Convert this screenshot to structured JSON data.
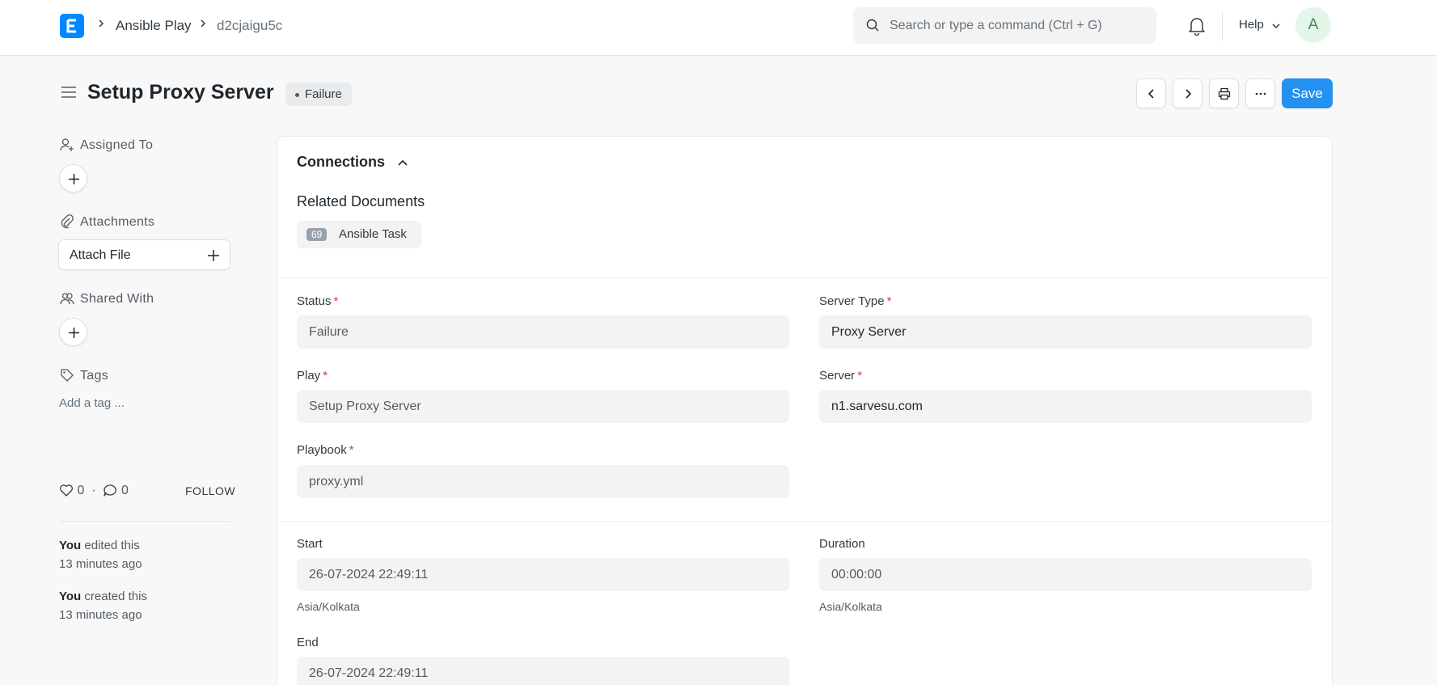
{
  "navbar": {
    "breadcrumbs": [
      "Ansible Play",
      "d2cjaigu5c"
    ],
    "search_placeholder": "Search or type a command (Ctrl + G)",
    "help_label": "Help",
    "avatar_initial": "A"
  },
  "page": {
    "title": "Setup Proxy Server",
    "status": "Failure",
    "save_label": "Save"
  },
  "sidebar": {
    "assigned_to": "Assigned To",
    "attachments": "Attachments",
    "attach_file": "Attach File",
    "shared_with": "Shared With",
    "tags": "Tags",
    "add_tag": "Add a tag ...",
    "likes": "0",
    "comments": "0",
    "follow": "FOLLOW",
    "activity": [
      {
        "who": "You",
        "action": "edited this",
        "when": "13 minutes ago"
      },
      {
        "who": "You",
        "action": "created this",
        "when": "13 minutes ago"
      }
    ]
  },
  "connections": {
    "title": "Connections",
    "related_documents": "Related Documents",
    "doc_count": "69",
    "doc_name": "Ansible Task"
  },
  "fields": {
    "status": {
      "label": "Status",
      "value": "Failure"
    },
    "server_type": {
      "label": "Server Type",
      "value": "Proxy Server"
    },
    "play": {
      "label": "Play",
      "value": "Setup Proxy Server"
    },
    "server": {
      "label": "Server",
      "value": "n1.sarvesu.com"
    },
    "playbook": {
      "label": "Playbook",
      "value": "proxy.yml"
    },
    "start": {
      "label": "Start",
      "value": "26-07-2024 22:49:11",
      "tz": "Asia/Kolkata"
    },
    "duration": {
      "label": "Duration",
      "value": "00:00:00",
      "tz": "Asia/Kolkata"
    },
    "end": {
      "label": "End",
      "value": "26-07-2024 22:49:11"
    }
  },
  "colors": {
    "primary": "#2490ef",
    "logo": "#0089ff",
    "required": "#e03636"
  }
}
